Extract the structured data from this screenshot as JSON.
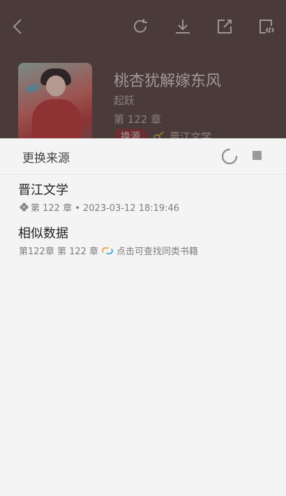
{
  "book": {
    "title": "桃杏犹解嫁东风",
    "author": "起跃",
    "chapter": "第 122 章",
    "switch_tag": "换源",
    "origin": "晋江文学"
  },
  "sheet": {
    "title": "更换来源"
  },
  "sources": [
    {
      "name": "晋江文学",
      "meta": "第 122 章 • 2023-03-12 18:19:46",
      "icon": "clover-icon"
    },
    {
      "name": "相似数据",
      "meta_prefix": "第122章 第 122 章",
      "meta_suffix": "点击可查找同类书籍",
      "icon": "link-icon"
    }
  ],
  "colors": {
    "header_bg": "#4a3b3a",
    "sheet_bg": "#f4f4f4",
    "tag_bg": "#6b2e32"
  }
}
